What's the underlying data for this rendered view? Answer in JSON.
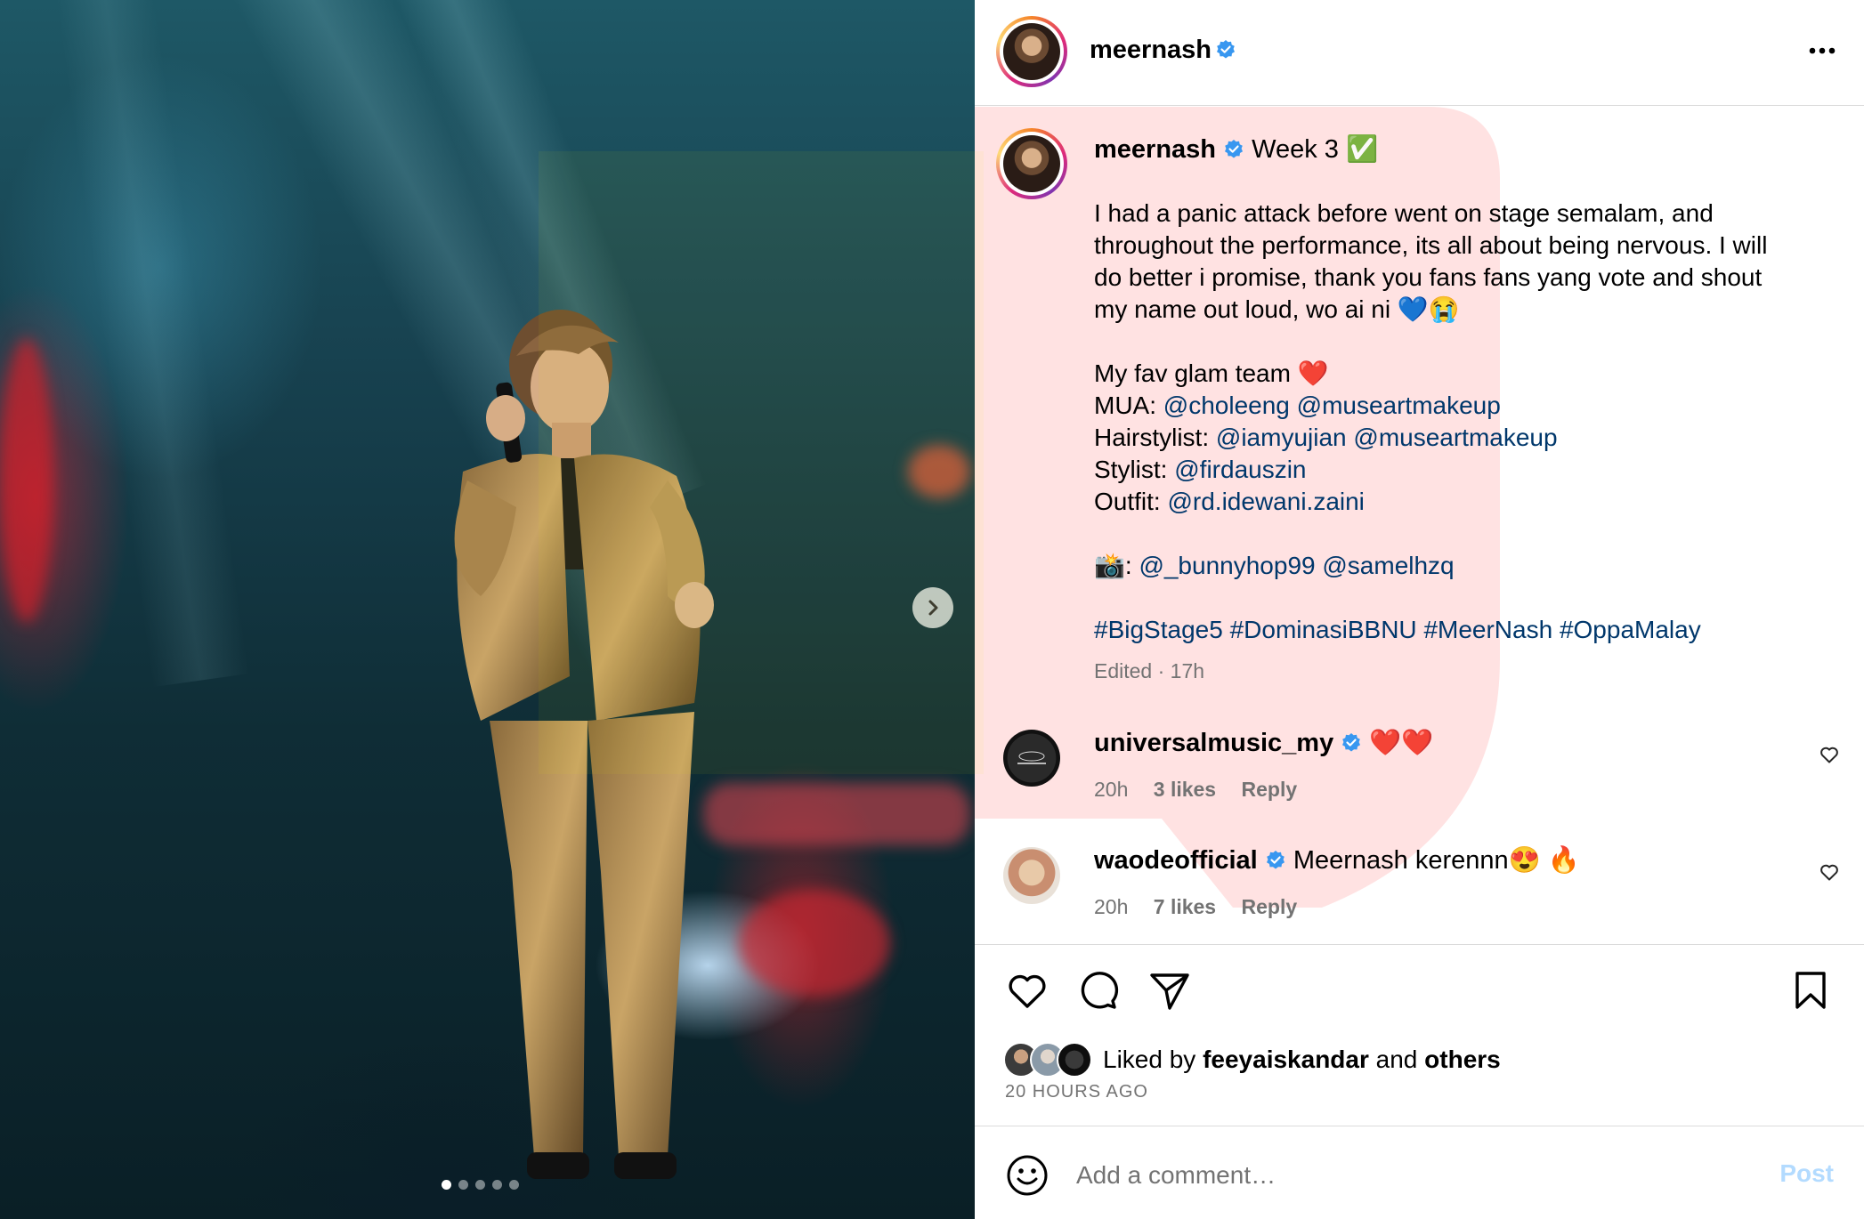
{
  "post": {
    "author": "meernash",
    "caption": {
      "title": "Week 3 ✅",
      "body_lines": [
        "I had a panic attack before went on stage semalam, and",
        "throughout the performance, its all about being nervous. I will",
        "do better i promise, thank you fans fans yang vote and shout",
        "my name out loud, wo ai ni 💙😭"
      ],
      "glam_heading": "My fav glam team ❤️",
      "credits": [
        {
          "label": "MUA:",
          "tags": [
            "@choleeng",
            "@museartmakeup"
          ]
        },
        {
          "label": "Hairstylist:",
          "tags": [
            "@iamyujian",
            "@museartmakeup"
          ]
        },
        {
          "label": "Stylist:",
          "tags": [
            "@firdauszin"
          ]
        },
        {
          "label": "Outfit:",
          "tags": [
            "@rd.idewani.zaini"
          ]
        }
      ],
      "camera_label": "📸:",
      "camera_tags": [
        "@_bunnyhop99",
        "@samelhzq"
      ],
      "hashtags": [
        "#BigStage5",
        "#DominasiBBNU",
        "#MeerNash",
        "#OppaMalay"
      ],
      "edited": "Edited · 17h"
    },
    "comments": [
      {
        "user": "universalmusic_my",
        "text": "❤️❤️",
        "time": "20h",
        "likes": "3 likes",
        "reply": "Reply"
      },
      {
        "user": "waodeofficial",
        "text": "Meernash kerennn😍 🔥",
        "time": "20h",
        "likes": "7 likes",
        "reply": "Reply"
      }
    ],
    "liked_by": {
      "prefix": "Liked by",
      "user": "feeyaiskandar",
      "conj": "and",
      "others": "others"
    },
    "time_ago": "20 HOURS AGO",
    "comment_placeholder": "Add a comment…",
    "post_button": "Post"
  },
  "carousel": {
    "count": 5,
    "active_index": 0
  },
  "icons": [
    "verified-badge-icon",
    "more-options-icon",
    "chevron-right-icon",
    "heart-icon",
    "comment-icon",
    "share-icon",
    "bookmark-icon",
    "emoji-icon"
  ],
  "colors": {
    "link": "#00376b",
    "verified": "#3897f0",
    "secondary_text": "#737373",
    "post_disabled": "#b3dbff",
    "watermark_red": "#ff3b3b",
    "watermark_yellow": "#f2e600"
  }
}
